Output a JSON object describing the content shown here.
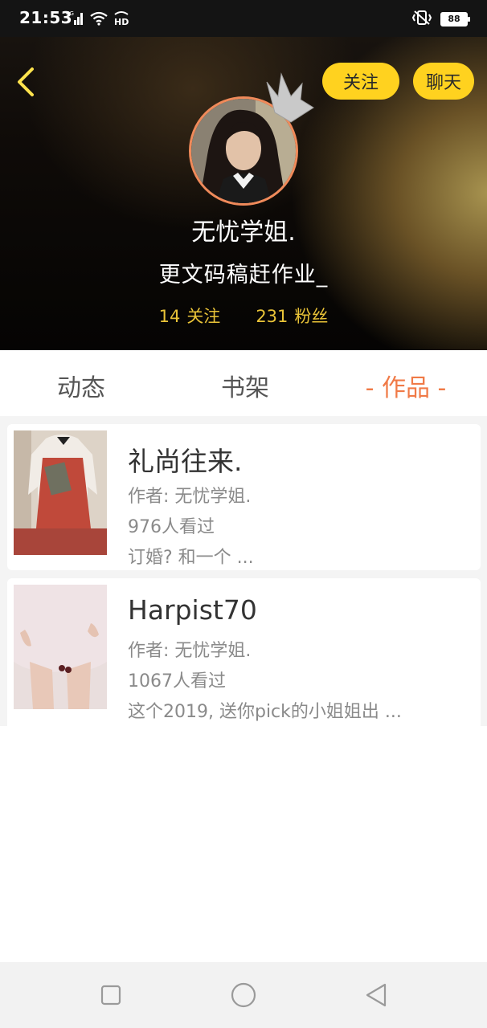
{
  "status_bar": {
    "time": "21:53",
    "network": "4G",
    "hd": "HD",
    "battery": "88"
  },
  "header": {
    "follow_label": "关注",
    "chat_label": "聊天",
    "nickname": "无忧学姐.",
    "signature": "更文码稿赶作业_",
    "following_count": "14",
    "following_label": "关注",
    "followers_count": "231",
    "followers_label": "粉丝"
  },
  "tabs": [
    {
      "label": "动态"
    },
    {
      "label": "书架"
    },
    {
      "label": "- 作品 -"
    }
  ],
  "works": [
    {
      "title": "礼尚往来.",
      "author": "作者: 无忧学姐.",
      "views": "976人看过",
      "desc": "订婚? 和一个 ..."
    },
    {
      "title": "Harpist70",
      "author": "作者: 无忧学姐.",
      "views": "1067人看过",
      "desc": "这个2019, 送你pick的小姐姐出 ..."
    }
  ],
  "colors": {
    "accent": "#f07a47",
    "pill": "#ffd21f",
    "stats": "#e9c338",
    "avatar_border": "#f08a5a"
  }
}
